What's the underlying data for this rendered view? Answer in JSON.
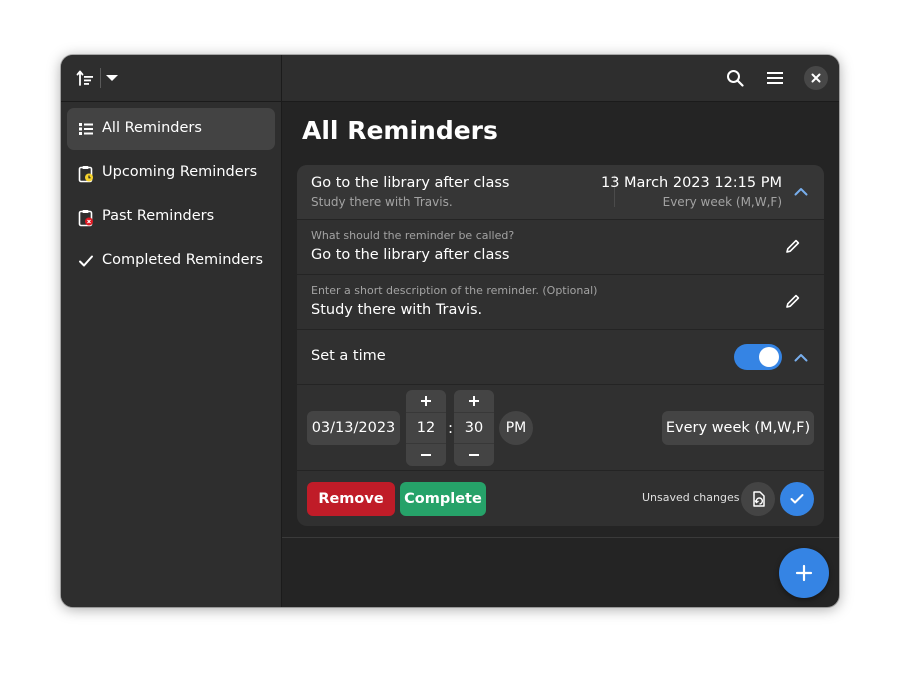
{
  "sidebar": {
    "items": [
      {
        "label": "All Reminders",
        "icon": "list-icon",
        "active": true
      },
      {
        "label": "Upcoming Reminders",
        "icon": "clipboard-clock-icon"
      },
      {
        "label": "Past Reminders",
        "icon": "clipboard-alert-icon"
      },
      {
        "label": "Completed Reminders",
        "icon": "check-icon"
      }
    ]
  },
  "main": {
    "title": "All Reminders"
  },
  "reminder": {
    "title": "Go to the library after class",
    "description": "Study there with Travis.",
    "datetime": "13 March 2023 12:15 PM",
    "repeat": "Every week (M,W,F)",
    "title_field": {
      "placeholder": "What should the reminder be called?",
      "value": "Go to the library after class"
    },
    "description_field": {
      "placeholder": "Enter a short description of the reminder. (Optional)",
      "value": "Study there with Travis."
    },
    "set_time_label": "Set a time",
    "set_time_enabled": true,
    "date": "03/13/2023",
    "hour": "12",
    "minute": "30",
    "time_separator": ":",
    "ampm": "PM",
    "repeat_button": "Every week (M,W,F)",
    "remove_label": "Remove",
    "complete_label": "Complete",
    "unsaved_label": "Unsaved changes"
  },
  "spin": {
    "plus": "+",
    "minus": "−"
  },
  "colors": {
    "accent": "#3584e4",
    "destructive": "#c01c28",
    "success": "#26a269",
    "window_bg": "#242424",
    "sidebar_bg": "#2e2e2e"
  }
}
